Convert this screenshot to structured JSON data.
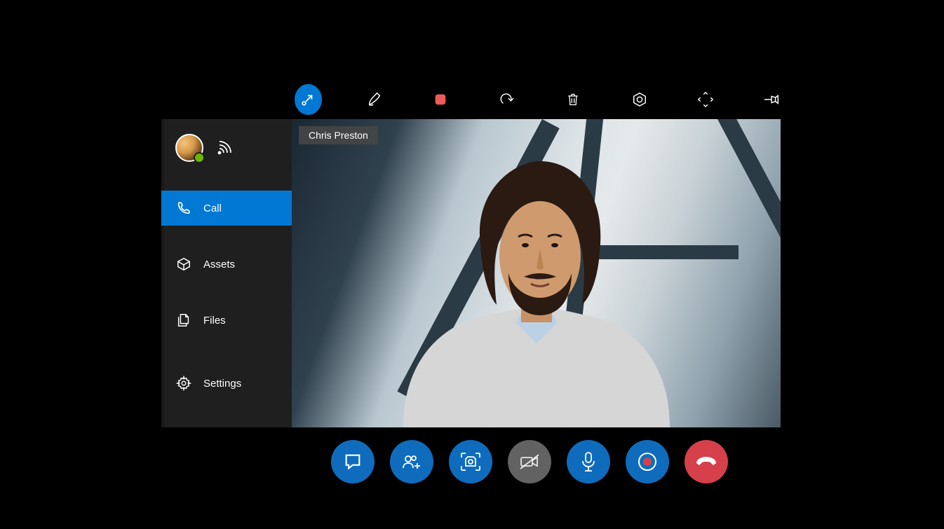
{
  "participant_name": "Chris Preston",
  "sidebar": {
    "items": [
      {
        "label": "Call",
        "icon": "phone-icon",
        "active": true
      },
      {
        "label": "Assets",
        "icon": "package-icon",
        "active": false
      },
      {
        "label": "Files",
        "icon": "files-icon",
        "active": false
      },
      {
        "label": "Settings",
        "icon": "gear-icon",
        "active": false
      }
    ]
  },
  "top_toolbar": {
    "items": [
      {
        "icon": "arrow-collapse-icon",
        "active": true
      },
      {
        "icon": "ink-pen-icon",
        "active": false
      },
      {
        "icon": "record-square-icon",
        "active": false
      },
      {
        "icon": "undo-icon",
        "active": false
      },
      {
        "icon": "trash-icon",
        "active": false
      },
      {
        "icon": "hexagon-settings-icon",
        "active": false
      },
      {
        "icon": "expand-icon",
        "active": false
      },
      {
        "icon": "pin-icon",
        "active": false
      }
    ]
  },
  "call_controls": {
    "items": [
      {
        "icon": "chat-icon",
        "style": "blue"
      },
      {
        "icon": "add-participant-icon",
        "style": "blue"
      },
      {
        "icon": "camera-capture-icon",
        "style": "blue"
      },
      {
        "icon": "video-off-icon",
        "style": "gray"
      },
      {
        "icon": "microphone-icon",
        "style": "blue"
      },
      {
        "icon": "record-icon",
        "style": "blue"
      },
      {
        "icon": "hangup-icon",
        "style": "red"
      }
    ]
  },
  "colors": {
    "accent_blue": "#0078d4",
    "button_blue": "#0f6cbd",
    "hangup_red": "#d5404a",
    "disabled_gray": "#626262",
    "sidebar_bg": "#1f1f1f"
  }
}
